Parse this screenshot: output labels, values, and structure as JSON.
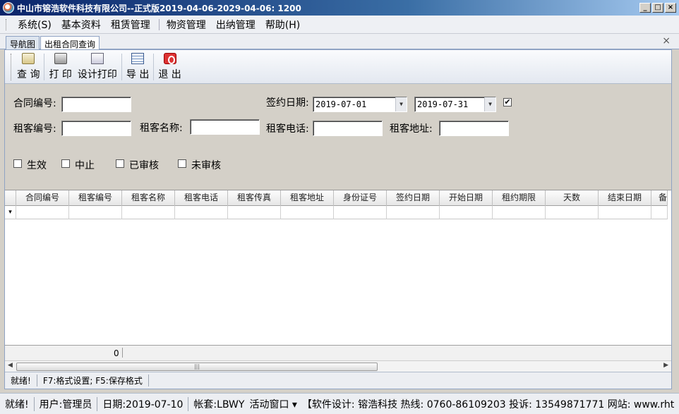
{
  "window": {
    "title": "中山市镕浩软件科技有限公司--正式版2019-04-06-2029-04-06: 1200",
    "min": "_",
    "max": "□",
    "close": "×"
  },
  "menu": [
    {
      "label": "系统(S)"
    },
    {
      "label": "基本资料"
    },
    {
      "label": "租赁管理"
    },
    {
      "label": "物资管理"
    },
    {
      "label": "出纳管理"
    },
    {
      "label": "帮助(H)"
    }
  ],
  "tabs": [
    {
      "label": "导航图"
    },
    {
      "label": "出租合同查询"
    }
  ],
  "tab_close": "×",
  "toolbar": {
    "query": "查 询",
    "print": "打 印",
    "design_print": "设计打印",
    "export": "导 出",
    "exit": "退 出"
  },
  "form": {
    "contract_no_label": "合同编号:",
    "sign_date_label": "签约日期:",
    "date_from": "2019-07-01",
    "date_to": "2019-07-31",
    "date_check": "✔",
    "tenant_no_label": "租客编号:",
    "tenant_name_label": "租客名称:",
    "tenant_phone_label": "租客电话:",
    "tenant_addr_label": "租客地址:",
    "status": [
      {
        "label": "生效"
      },
      {
        "label": "中止"
      },
      {
        "label": "已审核"
      },
      {
        "label": "未审核"
      }
    ]
  },
  "grid": {
    "columns": [
      "合同编号",
      "租客编号",
      "租客名称",
      "租客电话",
      "租客传真",
      "租客地址",
      "身份证号",
      "签约日期",
      "开始日期",
      "租约期限",
      "天数",
      "结束日期",
      "备"
    ],
    "new_row_marker": "▾",
    "sum_value": "0"
  },
  "inner_status": [
    "就绪!",
    "F7:格式设置; F5:保存格式"
  ],
  "statusbar": {
    "ready": "就绪!",
    "user": "用户:管理员",
    "date": "日期:2019-07-10",
    "account": "帐套:LBWY",
    "active_window": "活动窗口 ▾",
    "design": "【软件设计: 镕浩科技 热线: 0760-86109203 投诉: 13549871771 网站: www.rht"
  }
}
